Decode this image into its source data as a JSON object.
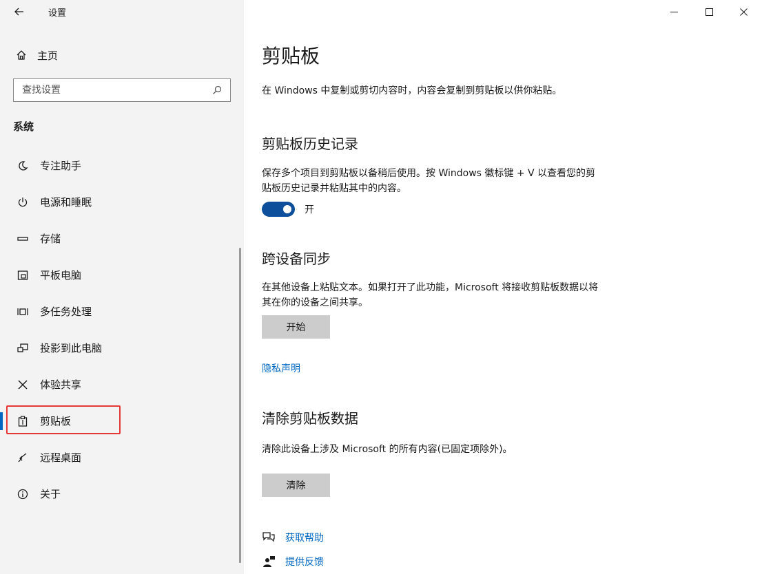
{
  "window": {
    "title": "设置"
  },
  "sidebar": {
    "home_label": "主页",
    "search_placeholder": "查找设置",
    "section_label": "系统",
    "items": [
      {
        "label": "专注助手",
        "icon": "moon-icon"
      },
      {
        "label": "电源和睡眠",
        "icon": "power-icon"
      },
      {
        "label": "存储",
        "icon": "storage-icon"
      },
      {
        "label": "平板电脑",
        "icon": "tablet-icon"
      },
      {
        "label": "多任务处理",
        "icon": "multitasking-icon"
      },
      {
        "label": "投影到此电脑",
        "icon": "project-icon"
      },
      {
        "label": "体验共享",
        "icon": "shared-experiences-icon"
      },
      {
        "label": "剪贴板",
        "icon": "clipboard-icon",
        "selected": true
      },
      {
        "label": "远程桌面",
        "icon": "remote-desktop-icon"
      },
      {
        "label": "关于",
        "icon": "info-icon"
      }
    ]
  },
  "main": {
    "title": "剪贴板",
    "intro": "在 Windows 中复制或剪切内容时，内容会复制到剪贴板以供你粘贴。",
    "history": {
      "heading": "剪贴板历史记录",
      "description": "保存多个项目到剪贴板以备稍后使用。按 Windows 徽标键 + V 以查看您的剪贴板历史记录并粘贴其中的内容。",
      "toggle_state": "开",
      "toggle_on": true
    },
    "sync": {
      "heading": "跨设备同步",
      "description": "在其他设备上粘贴文本。如果打开了此功能，Microsoft 将接收剪贴板数据以将其在你的设备之间共享。",
      "button": "开始",
      "privacy_link": "隐私声明"
    },
    "clear": {
      "heading": "清除剪贴板数据",
      "description": "清除此设备上涉及 Microsoft 的所有内容(已固定项除外)。",
      "button": "清除"
    },
    "help": {
      "get_help": "获取帮助",
      "feedback": "提供反馈"
    }
  },
  "colors": {
    "accent": "#0067c0",
    "toggle_on": "#0e4f9c",
    "selection_outline": "#e53935",
    "sidebar_bg": "#f3f3f3",
    "button_bg": "#cccccc"
  }
}
